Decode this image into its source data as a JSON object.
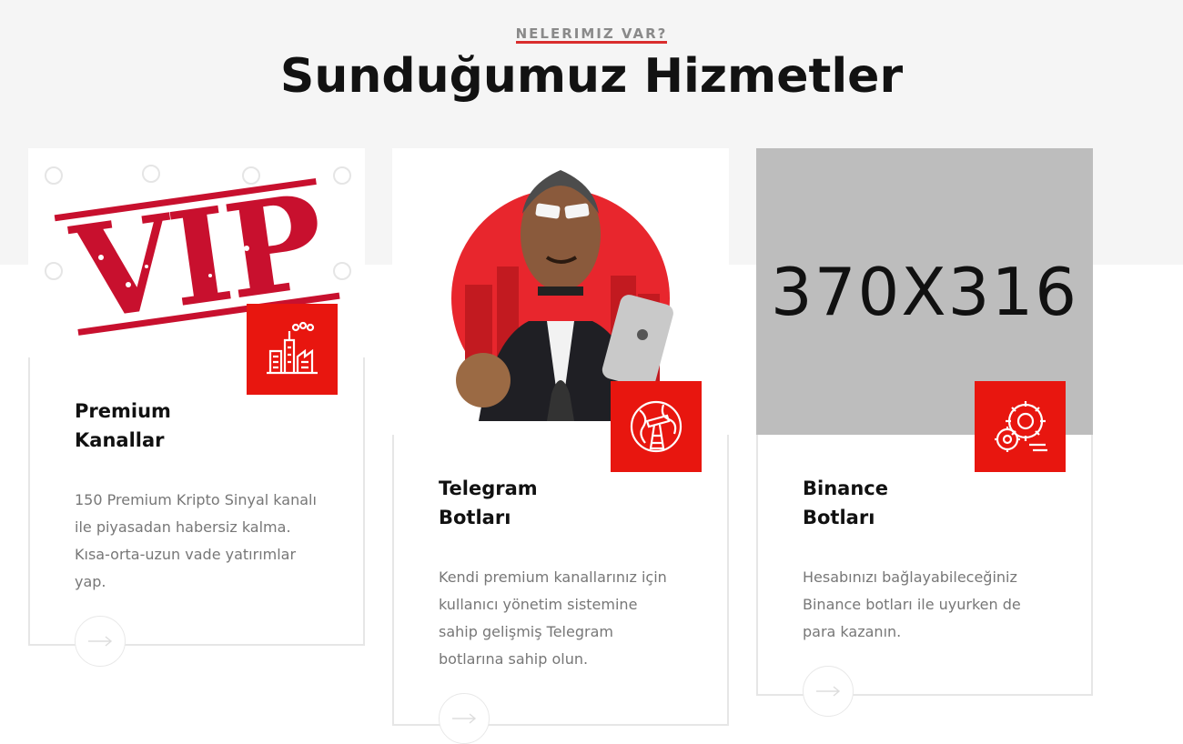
{
  "section": {
    "eyebrow": "NELERIMIZ VAR?",
    "title": "Sunduğumuz Hizmetler"
  },
  "cards": [
    {
      "title_line1": "Premium",
      "title_line2": "Kanallar",
      "text": "150 Premium Kripto Sinyal kanalı ile piyasadan habersiz kalma. Kısa-orta-uzun vade yatırımlar yap.",
      "image_text": "VIP",
      "icon": "factory-icon"
    },
    {
      "title_line1": "Telegram",
      "title_line2": "Botları",
      "text": "Kendi premium kanallarınız için kullanıcı yönetim sistemine sahip gelişmiş Telegram botlarına sahip olun.",
      "icon": "oil-pump-icon"
    },
    {
      "title_line1": "Binance",
      "title_line2": "Botları",
      "text": "Hesabınızı bağlayabileceğiniz Binance botları ile uyurken de para kazanın.",
      "image_text": "370X316",
      "icon": "gears-icon"
    }
  ],
  "colors": {
    "accent": "#e8160f",
    "eyebrow_underline": "#d92d2d",
    "section_bg": "#f5f5f5"
  }
}
